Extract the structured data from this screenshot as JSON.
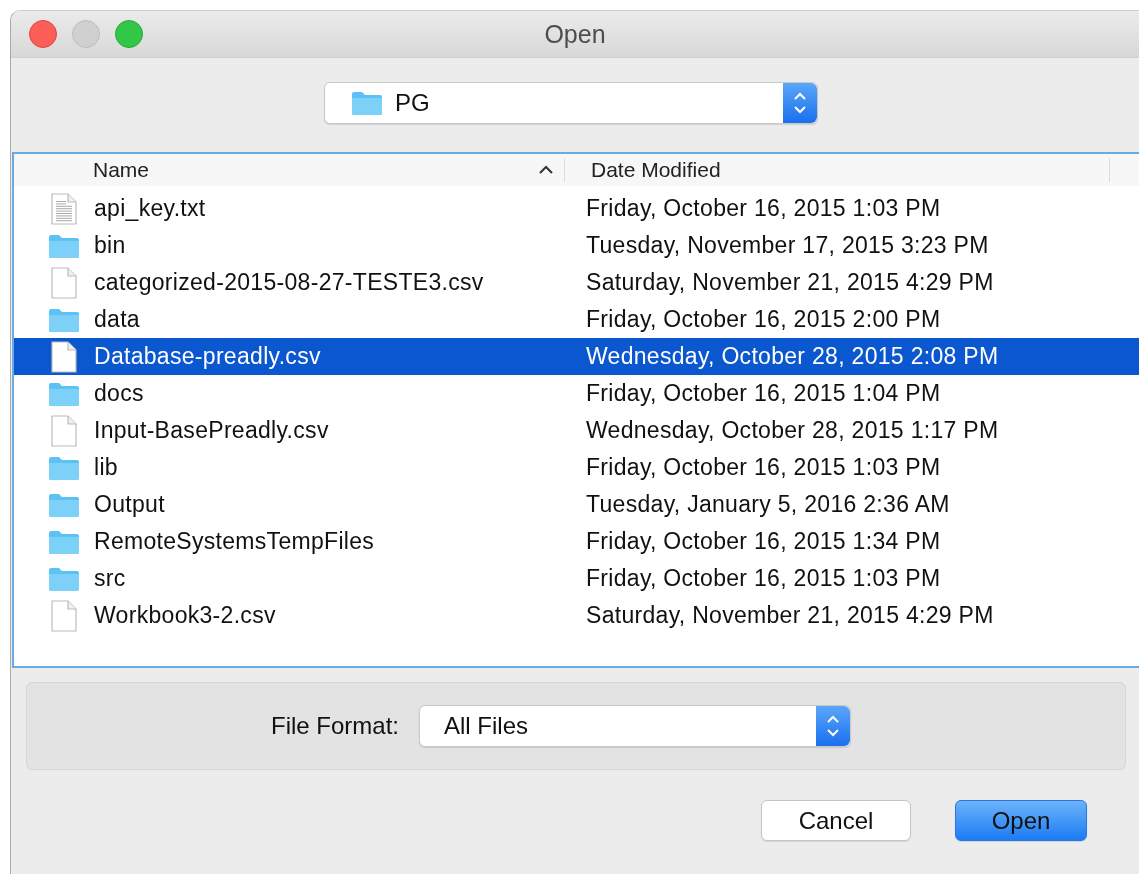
{
  "window": {
    "title": "Open"
  },
  "location": {
    "label": "PG"
  },
  "file_list": {
    "columns": [
      {
        "label": "Name",
        "sorted": true
      },
      {
        "label": "Date Modified",
        "sorted": false
      }
    ],
    "rows": [
      {
        "name": "api_key.txt",
        "date": "Friday, October 16, 2015 1:03 PM",
        "kind": "text",
        "selected": false
      },
      {
        "name": "bin",
        "date": "Tuesday, November 17, 2015 3:23 PM",
        "kind": "folder",
        "selected": false
      },
      {
        "name": "categorized-2015-08-27-TESTE3.csv",
        "date": "Saturday, November 21, 2015 4:29 PM",
        "kind": "file",
        "selected": false
      },
      {
        "name": "data",
        "date": "Friday, October 16, 2015 2:00 PM",
        "kind": "folder",
        "selected": false
      },
      {
        "name": "Database-preadly.csv",
        "date": "Wednesday, October 28, 2015 2:08 PM",
        "kind": "file",
        "selected": true
      },
      {
        "name": "docs",
        "date": "Friday, October 16, 2015 1:04 PM",
        "kind": "folder",
        "selected": false
      },
      {
        "name": "Input-BasePreadly.csv",
        "date": "Wednesday, October 28, 2015 1:17 PM",
        "kind": "file",
        "selected": false
      },
      {
        "name": "lib",
        "date": "Friday, October 16, 2015 1:03 PM",
        "kind": "folder",
        "selected": false
      },
      {
        "name": "Output",
        "date": "Tuesday, January 5, 2016 2:36 AM",
        "kind": "folder",
        "selected": false
      },
      {
        "name": "RemoteSystemsTempFiles",
        "date": "Friday, October 16, 2015 1:34 PM",
        "kind": "folder",
        "selected": false
      },
      {
        "name": "src",
        "date": "Friday, October 16, 2015 1:03 PM",
        "kind": "folder",
        "selected": false
      },
      {
        "name": "Workbook3-2.csv",
        "date": "Saturday, November 21, 2015 4:29 PM",
        "kind": "file",
        "selected": false
      }
    ]
  },
  "file_format": {
    "label": "File Format:",
    "value": "All Files"
  },
  "buttons": [
    {
      "label": "Cancel",
      "default": false
    },
    {
      "label": "Open",
      "default": true
    }
  ]
}
